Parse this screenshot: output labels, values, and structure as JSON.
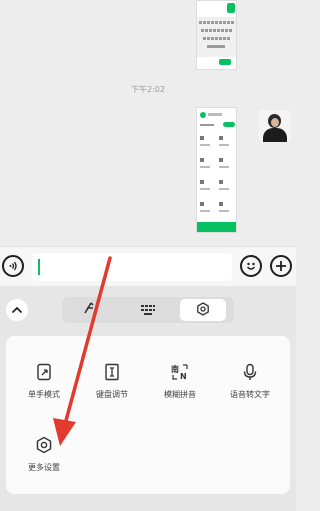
{
  "chat": {
    "timestamp": "下午2:02"
  },
  "input_bar": {
    "voice_icon": "voice-icon",
    "emoji_icon": "emoji-icon",
    "plus_icon": "plus-icon"
  },
  "toolbar": {
    "collapse_icon": "chevron-up-icon",
    "tabs": [
      {
        "icon": "handwriting-icon",
        "active": false
      },
      {
        "icon": "keyboard-icon",
        "active": false
      },
      {
        "icon": "settings-icon",
        "active": true
      }
    ]
  },
  "settings_panel": {
    "items": [
      {
        "label": "单手模式",
        "icon": "one-hand-icon"
      },
      {
        "label": "键盘调节",
        "icon": "keyboard-adjust-icon"
      },
      {
        "label": "模糊拼音",
        "icon": "fuzzy-pinyin-icon"
      },
      {
        "label": "语音转文字",
        "icon": "voice-to-text-icon"
      },
      {
        "label": "更多设置",
        "icon": "settings-icon"
      }
    ]
  },
  "colors": {
    "accent": "#07c160",
    "annotation_arrow": "#e23a2e",
    "background": "#ededed"
  }
}
